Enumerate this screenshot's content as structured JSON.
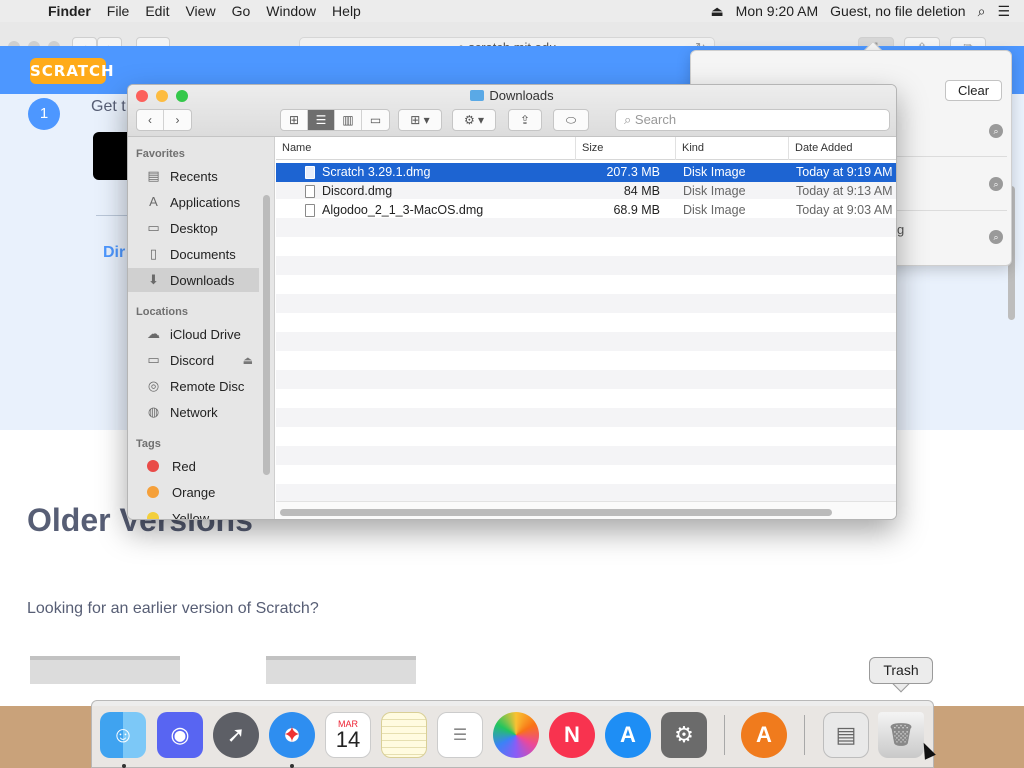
{
  "menubar": {
    "app": "Finder",
    "items": [
      "File",
      "Edit",
      "View",
      "Go",
      "Window",
      "Help"
    ],
    "time": "Mon 9:20 AM",
    "user": "Guest, no file deletion"
  },
  "safari": {
    "url": "scratch.mit.edu",
    "new_tab": "+"
  },
  "page": {
    "logo": "SCRATCH",
    "step_number": "1",
    "step_text": "Get t",
    "dir_link": "Dir",
    "older_title": "Older Versions",
    "older_sub": "Looking for an earlier version of Scratch?"
  },
  "downloads_popover": {
    "clear_label": "Clear",
    "fragment": "g"
  },
  "finder": {
    "title": "Downloads",
    "search_placeholder": "Search",
    "sidebar": {
      "favorites_head": "Favorites",
      "favorites": [
        {
          "label": "Recents",
          "icon": "recents-icon"
        },
        {
          "label": "Applications",
          "icon": "applications-icon"
        },
        {
          "label": "Desktop",
          "icon": "desktop-icon"
        },
        {
          "label": "Documents",
          "icon": "documents-icon"
        },
        {
          "label": "Downloads",
          "icon": "downloads-icon"
        }
      ],
      "locations_head": "Locations",
      "locations": [
        {
          "label": "iCloud Drive",
          "icon": "cloud-icon"
        },
        {
          "label": "Discord",
          "icon": "disk-icon"
        },
        {
          "label": "Remote Disc",
          "icon": "disc-icon"
        },
        {
          "label": "Network",
          "icon": "network-icon"
        }
      ],
      "tags_head": "Tags",
      "tags": [
        {
          "label": "Red",
          "color": "#e94b48"
        },
        {
          "label": "Orange",
          "color": "#f5a03a"
        },
        {
          "label": "Yellow",
          "color": "#f3cf3b"
        }
      ]
    },
    "columns": [
      "Name",
      "Size",
      "Kind",
      "Date Added"
    ],
    "files": [
      {
        "name": "Scratch 3.29.1.dmg",
        "size": "207.3 MB",
        "kind": "Disk Image",
        "date": "Today at 9:19 AM"
      },
      {
        "name": "Discord.dmg",
        "size": "84 MB",
        "kind": "Disk Image",
        "date": "Today at 9:13 AM"
      },
      {
        "name": "Algodoo_2_1_3-MacOS.dmg",
        "size": "68.9 MB",
        "kind": "Disk Image",
        "date": "Today at 9:03 AM"
      }
    ]
  },
  "dock": {
    "calendar_month": "MAR",
    "calendar_day": "14",
    "trash_tooltip": "Trash"
  },
  "colors": {
    "selection": "#1d64d2",
    "scratch_blue": "#4d97ff",
    "scratch_orange": "#ffab19"
  }
}
